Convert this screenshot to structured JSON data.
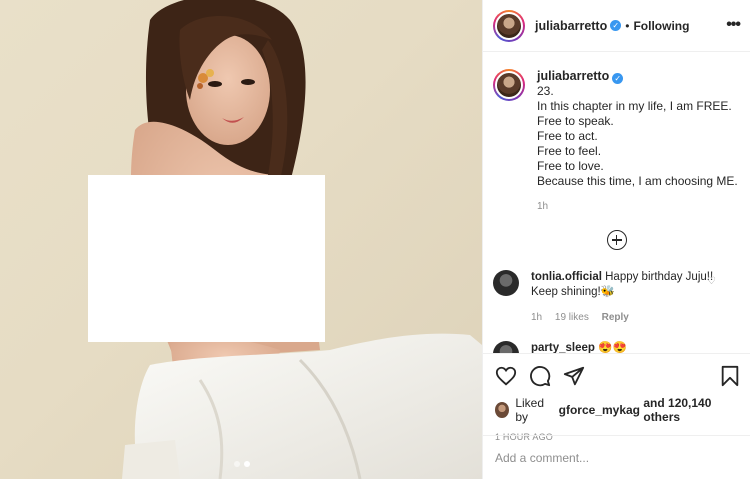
{
  "post": {
    "username": "juliabarretto",
    "follow_label": "Following",
    "caption_lines": [
      "23.",
      "In this chapter in my life, I am FREE.",
      "Free to speak.",
      "Free to act.",
      "Free to feel.",
      "Free to love.",
      "Because this time, I am choosing ME."
    ],
    "caption_time": "1h"
  },
  "comments": [
    {
      "username": "tonlia.official",
      "text": "Happy birthday Juju!! Keep shining!🐝",
      "time": "1h",
      "likes": "19 likes",
      "reply": "Reply"
    },
    {
      "username": "party_sleep",
      "text": "😍😍"
    }
  ],
  "likes": {
    "prefix": "Liked by",
    "user": "gforce_mykag",
    "rest": "and 120,140 others"
  },
  "timestamp": "1 HOUR AGO",
  "add_comment": {
    "placeholder": "Add a comment..."
  },
  "carousel": {
    "count": 2,
    "active": 1
  },
  "colors": {
    "verified": "#3897f0",
    "border": "#efefef",
    "muted": "#8e8e8e"
  }
}
